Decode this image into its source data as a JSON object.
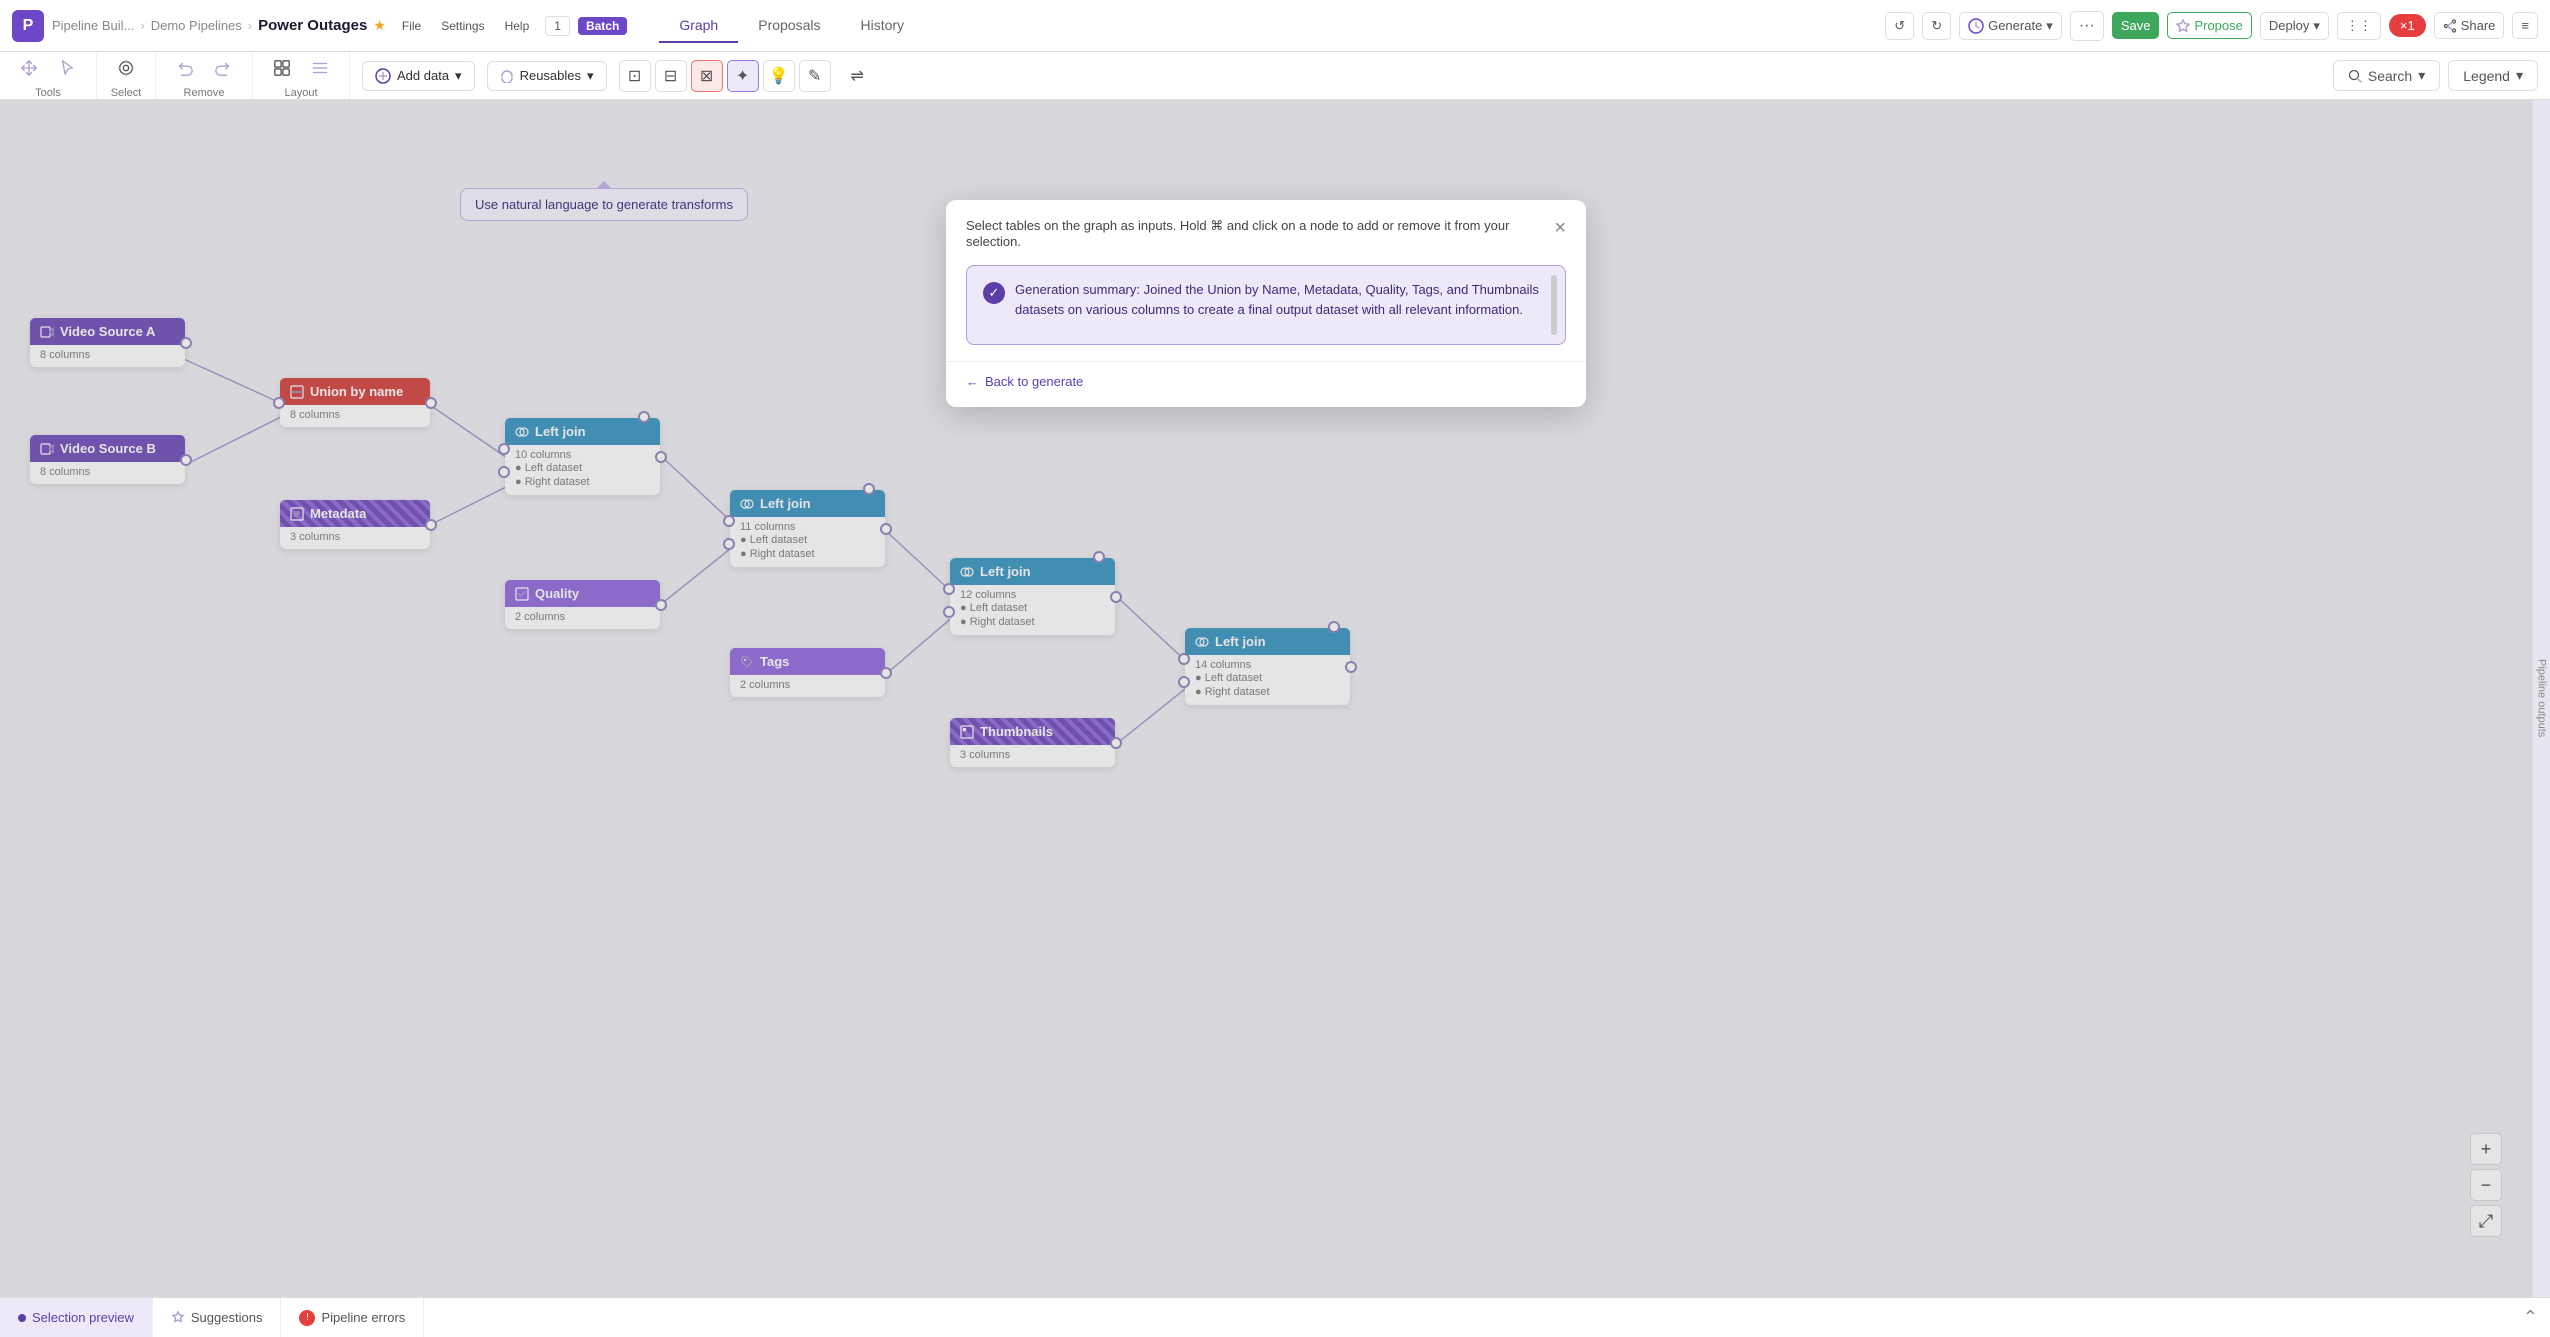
{
  "app": {
    "logo": "P",
    "breadcrumb": {
      "parent1": "Pipeline Buil...",
      "parent2": "Demo Pipelines",
      "current": "Power Outages"
    }
  },
  "top_tabs": [
    {
      "label": "Graph",
      "active": true
    },
    {
      "label": "Proposals",
      "active": false
    },
    {
      "label": "History",
      "active": false
    }
  ],
  "top_bar": {
    "file_label": "File",
    "settings_label": "Settings",
    "help_label": "Help",
    "pi_badge": "1",
    "batch_badge": "Batch",
    "generate_label": "Generate",
    "save_label": "Save",
    "propose_label": "Propose",
    "deploy_label": "Deploy",
    "red_badge": "×1",
    "share_label": "Share"
  },
  "toolbar": {
    "tools_label": "Tools",
    "select_label": "Select",
    "remove_label": "Remove",
    "layout_label": "Layout",
    "add_data_label": "Add data",
    "reusables_label": "Reusables",
    "search_label": "Search",
    "legend_label": "Legend"
  },
  "tooltip": {
    "text": "Use natural language to generate transforms"
  },
  "modal": {
    "instruction": "Select tables on the graph as inputs. Hold ⌘ and click on a node to add or remove it from your selection.",
    "summary_text": "Generation summary: Joined the Union by Name, Metadata, Quality, Tags, and Thumbnails datasets on various columns to create a final output dataset with all relevant information.",
    "back_label": "Back to generate"
  },
  "nodes": {
    "video_source_a": {
      "title": "Video Source A",
      "columns": "8 columns"
    },
    "video_source_b": {
      "title": "Video Source B",
      "columns": "8 columns"
    },
    "union_by_name": {
      "title": "Union by name",
      "columns": "8 columns"
    },
    "metadata": {
      "title": "Metadata",
      "columns": "3 columns"
    },
    "quality": {
      "title": "Quality",
      "columns": "2 columns"
    },
    "tags": {
      "title": "Tags",
      "columns": "2 columns"
    },
    "thumbnails": {
      "title": "Thumbnails",
      "columns": "3 columns"
    },
    "left_join_1": {
      "title": "Left join",
      "columns": "10 columns",
      "left": "Left dataset",
      "right": "Right dataset"
    },
    "left_join_2": {
      "title": "Left join",
      "columns": "11 columns",
      "left": "Left dataset",
      "right": "Right dataset"
    },
    "left_join_3": {
      "title": "Left join",
      "columns": "12 columns",
      "left": "Left dataset",
      "right": "Right dataset"
    },
    "left_join_4": {
      "title": "Left join",
      "columns": "14 columns",
      "left": "Left dataset",
      "right": "Right dataset"
    }
  },
  "bottom_bar": {
    "selection_preview": "Selection preview",
    "suggestions": "Suggestions",
    "pipeline_errors": "Pipeline errors"
  },
  "right_sidebar": {
    "label": "Pipeline outputs"
  }
}
